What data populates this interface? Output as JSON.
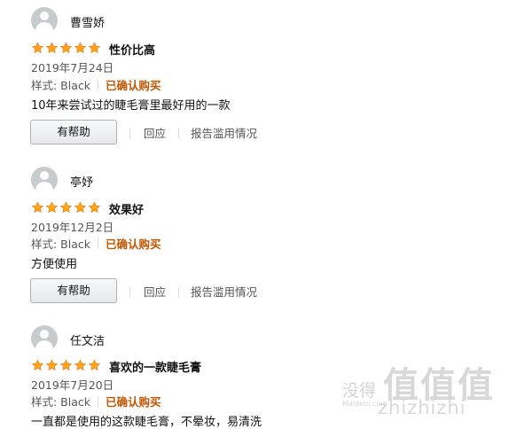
{
  "reviews": [
    {
      "name": "曹雪娇",
      "rating": 5,
      "title": "性价比高",
      "date": "2019年7月24日",
      "style_label": "样式: Black",
      "verified": "已确认购买",
      "content": "10年来尝试过的睫毛膏里最好用的一款",
      "helpful": "有帮助",
      "reply": "回应",
      "report": "报告滥用情况"
    },
    {
      "name": "亭妤",
      "rating": 5,
      "title": "效果好",
      "date": "2019年12月2日",
      "style_label": "样式: Black",
      "verified": "已确认购买",
      "content": "方便使用",
      "helpful": "有帮助",
      "reply": "回应",
      "report": "报告滥用情况"
    },
    {
      "name": "任文洁",
      "rating": 5,
      "title": "喜欢的一款睫毛膏",
      "date": "2019年7月20日",
      "style_label": "样式: Black",
      "verified": "已确认购买",
      "content": "一直都是使用的这款睫毛膏，不晕妆，易清洗"
    }
  ],
  "watermark": {
    "text": "没得",
    "big": "值值值",
    "site": "Maidebi.com",
    "pinyin": "zhizhizhi"
  },
  "colors": {
    "star": "#ffa41c",
    "verified": "#c45500"
  }
}
